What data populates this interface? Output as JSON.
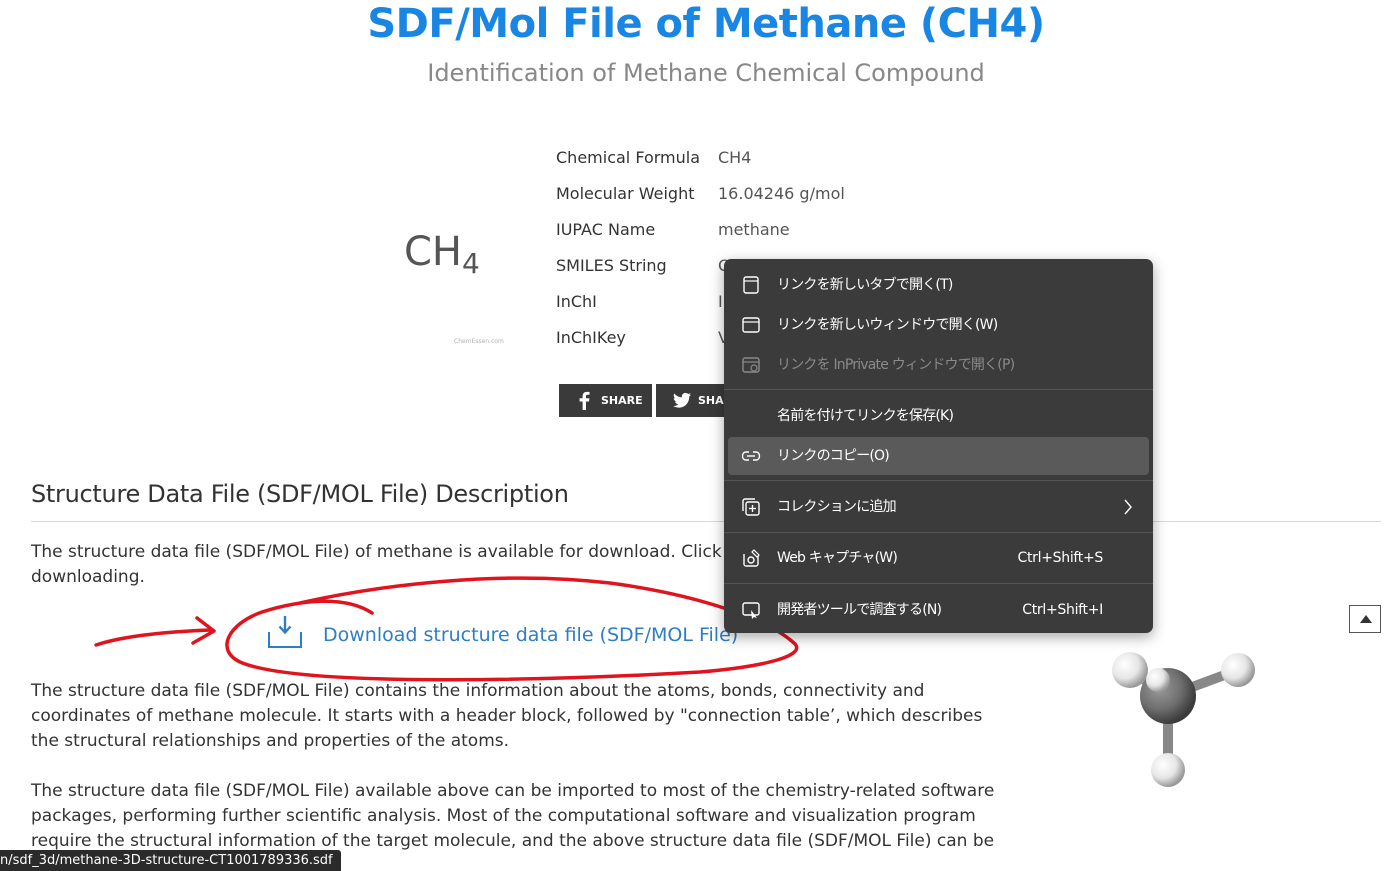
{
  "header": {
    "title": "SDF/Mol File of Methane (CH4)",
    "subtitle": "Identification of Methane Chemical Compound"
  },
  "formula_image": {
    "main": "CH",
    "subscript": "4",
    "watermark": "ChemEssen.com"
  },
  "properties": [
    {
      "label": "Chemical Formula",
      "value": "CH4"
    },
    {
      "label": "Molecular Weight",
      "value": "16.04246 g/mol"
    },
    {
      "label": "IUPAC Name",
      "value": "methane"
    },
    {
      "label": "SMILES String",
      "value": "C"
    },
    {
      "label": "InChI",
      "value": "In"
    },
    {
      "label": "InChIKey",
      "value": "V"
    }
  ],
  "share": {
    "facebook_label": "SHARE",
    "twitter_label": "SHARE"
  },
  "section": {
    "heading": "Structure Data File (SDF/MOL File) Description",
    "intro_line1": "The structure data file (SDF/MOL File) of methane is available for download. Click th",
    "intro_line2": "downloading.",
    "download_label": "Download structure data file (SDF/MOL File)",
    "para1": "The structure data file (SDF/MOL File) contains the information about the atoms, bonds, connectivity and coordinates of methane molecule. It starts with a header block, followed by \"connection table’, which describes the structural relationships and properties of the atoms.",
    "para2": "The structure data file (SDF/MOL File) available above can be imported to most of the chemistry-related software packages, performing further scientific analysis. Most of the computational software and visualization program require the structural information of the target molecule, and the above structure data file (SDF/MOL File) can be a"
  },
  "status_bar": {
    "url": "n/sdf_3d/methane-3D-structure-CT1001789336.sdf"
  },
  "context_menu": {
    "items": [
      {
        "label": "リンクを新しいタブで開く(T)",
        "icon": "new-tab-icon",
        "shortcut": ""
      },
      {
        "label": "リンクを新しいウィンドウで開く(W)",
        "icon": "new-window-icon",
        "shortcut": ""
      },
      {
        "label": "リンクを InPrivate ウィンドウで開く(P)",
        "icon": "inprivate-window-icon",
        "shortcut": "",
        "disabled": true
      },
      {
        "label": "名前を付けてリンクを保存(K)",
        "icon": "",
        "shortcut": ""
      },
      {
        "label": "リンクのコピー(O)",
        "icon": "link-icon",
        "shortcut": "",
        "highlighted": true
      },
      {
        "label": "コレクションに追加",
        "icon": "collections-icon",
        "shortcut": "",
        "submenu": true
      },
      {
        "label": "Web キャプチャ(W)",
        "icon": "web-capture-icon",
        "shortcut": "Ctrl+Shift+S"
      },
      {
        "label": "開発者ツールで調査する(N)",
        "icon": "devtools-icon",
        "shortcut": "Ctrl+Shift+I"
      }
    ]
  },
  "colors": {
    "title": "#1a86e3",
    "link": "#2f7dc5",
    "annotation": "#e0141e",
    "menu_bg": "#3b3b3b",
    "menu_highlight": "#5a5a5a"
  }
}
